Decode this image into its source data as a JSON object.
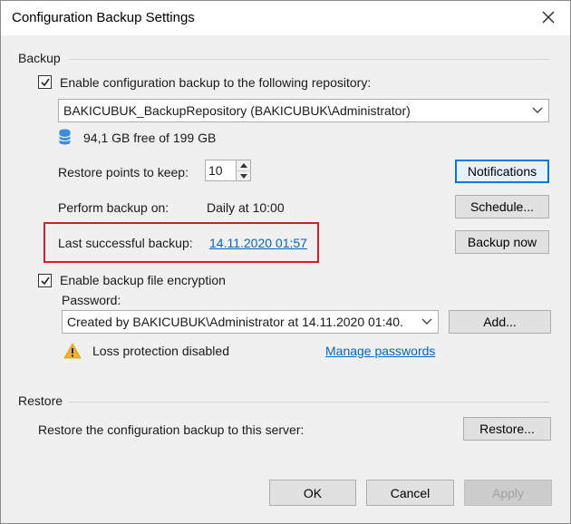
{
  "window": {
    "title": "Configuration Backup Settings",
    "close_icon": "close-icon"
  },
  "backup": {
    "section_title": "Backup",
    "enable_label": "Enable configuration backup to the following repository:",
    "enable_checked": true,
    "repository": "BAKICUBUK_BackupRepository (BAKICUBUK\\Administrator)",
    "storage_icon": "database-icon",
    "free_space": "94,1 GB free of 199 GB",
    "restore_points_label": "Restore points to keep:",
    "restore_points_value": "10",
    "notifications_label": "Notifications",
    "perform_backup_label": "Perform backup on:",
    "perform_backup_value": "Daily at 10:00",
    "schedule_label": "Schedule...",
    "last_backup_label": "Last successful backup:",
    "last_backup_value": "14.11.2020 01:57",
    "backup_now_label": "Backup now",
    "encryption_label": "Enable backup file encryption",
    "encryption_checked": true,
    "password_label": "Password:",
    "password_value": "Created by BAKICUBUK\\Administrator at 14.11.2020 01:40.",
    "add_label": "Add...",
    "warning_icon": "warning-icon",
    "loss_protection": "Loss protection disabled",
    "manage_passwords": "Manage passwords"
  },
  "restore": {
    "section_title": "Restore",
    "description": "Restore the configuration backup to this server:",
    "restore_label": "Restore..."
  },
  "footer": {
    "ok_label": "OK",
    "cancel_label": "Cancel",
    "apply_label": "Apply"
  },
  "colors": {
    "accent": "#0078d7",
    "link": "#0563c1",
    "highlight": "#d0202a",
    "warning": "#f2b41c"
  }
}
